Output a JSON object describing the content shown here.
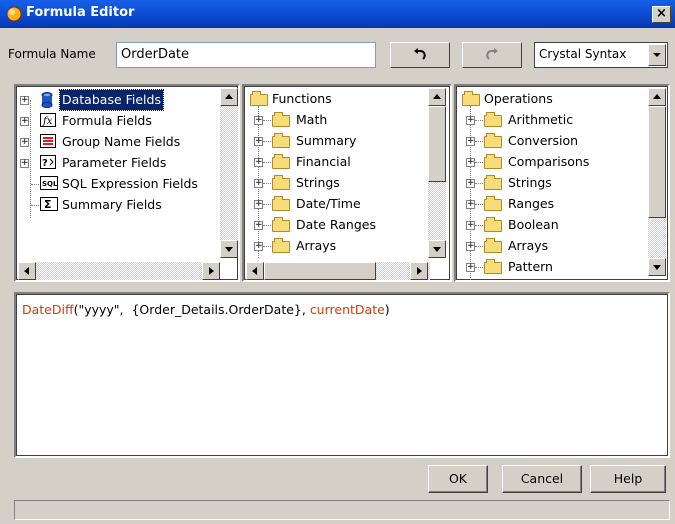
{
  "window": {
    "title": "Formula Editor",
    "close_label": "×"
  },
  "formula": {
    "name_label": "Formula Name",
    "name_value": "OrderDate",
    "undo_icon": "undo-icon",
    "redo_icon": "redo-icon",
    "syntax_value": "Crystal Syntax"
  },
  "fields_tree": {
    "items": [
      {
        "label": "Database Fields",
        "icon": "database-icon",
        "expandable": true,
        "selected": true
      },
      {
        "label": "Formula Fields",
        "icon": "formula-field-icon",
        "expandable": true
      },
      {
        "label": "Group Name Fields",
        "icon": "group-name-icon",
        "expandable": true
      },
      {
        "label": "Parameter Fields",
        "icon": "parameter-icon",
        "expandable": true
      },
      {
        "label": "SQL Expression Fields",
        "icon": "sql-icon",
        "expandable": false
      },
      {
        "label": "Summary Fields",
        "icon": "sum-icon",
        "expandable": false
      }
    ]
  },
  "functions_tree": {
    "root": "Functions",
    "items": [
      "Math",
      "Summary",
      "Financial",
      "Strings",
      "Date/Time",
      "Date Ranges",
      "Arrays"
    ]
  },
  "operations_tree": {
    "root": "Operations",
    "items": [
      "Arithmetic",
      "Conversion",
      "Comparisons",
      "Strings",
      "Ranges",
      "Boolean",
      "Arrays",
      "Pattern"
    ]
  },
  "editor": {
    "fn_name": "DateDiff",
    "part1": "(\"yyyy\",  {Order_Details.OrderDate}, ",
    "keyword": "currentDate",
    "part2": ")"
  },
  "buttons": {
    "ok": "OK",
    "cancel": "Cancel",
    "help": "Help"
  },
  "colors": {
    "title_bar": "#0a4bd1",
    "keyword": "#c8410a",
    "window_bg": "#d4d0c8"
  }
}
